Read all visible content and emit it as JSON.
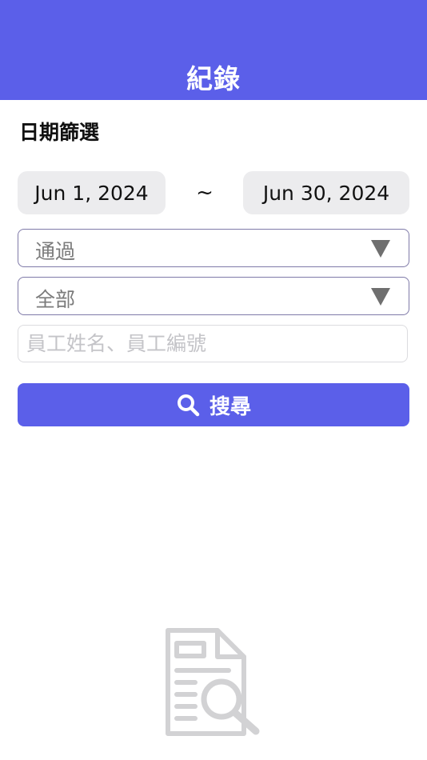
{
  "header": {
    "title": "紀錄"
  },
  "filter": {
    "section_title": "日期篩選",
    "date_start": "Jun 1, 2024",
    "date_separator": "~",
    "date_end": "Jun 30, 2024",
    "status_select": {
      "value": "通過",
      "icon": "triangle-down-icon"
    },
    "scope_select": {
      "value": "全部",
      "icon": "triangle-down-icon"
    },
    "search_input": {
      "value": "",
      "placeholder": "員工姓名、員工編號"
    },
    "search_button": {
      "label": "搜尋",
      "icon": "magnifier-icon"
    }
  },
  "empty_state": {
    "icon": "document-search-icon"
  },
  "colors": {
    "accent": "#5b5fe9",
    "select_border": "#7f7aa8",
    "chip_background": "#ececee",
    "placeholder": "#c4c4c8",
    "empty_icon": "#d2d2d4"
  }
}
